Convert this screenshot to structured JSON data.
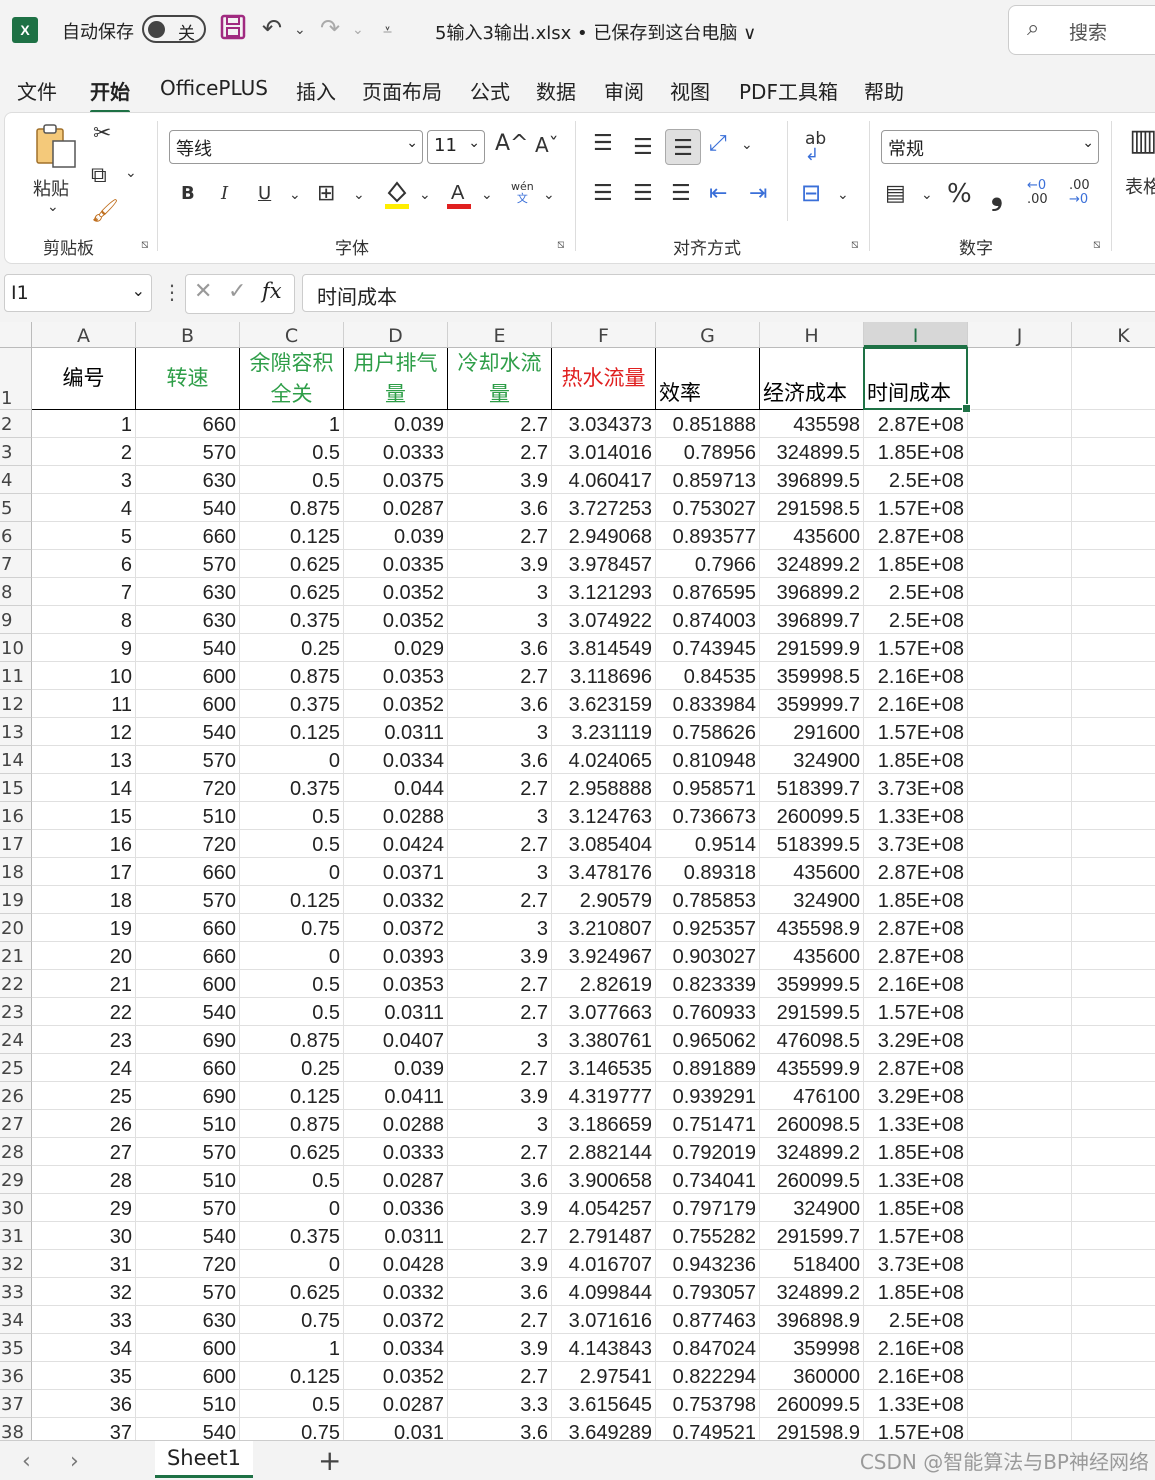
{
  "window": {
    "app_icon": "X",
    "autosave_label": "自动保存",
    "autosave_state": "关",
    "file_title": "5输入3输出.xlsx • 已保存到这台电脑 ∨",
    "search_placeholder": "搜索"
  },
  "menu": {
    "items": [
      "文件",
      "开始",
      "OfficePLUS",
      "插入",
      "页面布局",
      "公式",
      "数据",
      "审阅",
      "视图",
      "PDF工具箱",
      "帮助"
    ],
    "active": "开始"
  },
  "ribbon": {
    "clipboard": {
      "paste_label": "粘贴",
      "group_label": "剪贴板"
    },
    "font": {
      "font_name": "等线",
      "font_size": "11",
      "group_label": "字体",
      "bold": "B",
      "italic": "I",
      "underline": "U",
      "grow": "A^",
      "shrink": "Aˇ",
      "phonetic_top": "wén",
      "phonetic_bottom": "文"
    },
    "alignment": {
      "group_label": "对齐方式",
      "wrap_label": "ab"
    },
    "number": {
      "format": "常规",
      "group_label": "数字",
      "percent": "%",
      "comma": "❟",
      "inc_top": "←0",
      "inc_bottom": ".00",
      "dec_top": ".00",
      "dec_bottom": "→0"
    },
    "tables": {
      "label": "表格"
    }
  },
  "formula_bar": {
    "name_box": "I1",
    "fx": "fx",
    "content": "时间成本"
  },
  "sheet": {
    "columns": [
      "A",
      "B",
      "C",
      "D",
      "E",
      "F",
      "G",
      "H",
      "I",
      "J",
      "K"
    ],
    "selected_column": "I",
    "header_row": [
      {
        "text": "编号",
        "color": "#000000",
        "align": "center"
      },
      {
        "text": "转速",
        "color": "#2e9e48",
        "align": "center"
      },
      {
        "text": "余隙容积全关",
        "color": "#2e9e48",
        "align": "center"
      },
      {
        "text": "用户排气量",
        "color": "#2e9e48",
        "align": "center"
      },
      {
        "text": "冷却水流量",
        "color": "#2e9e48",
        "align": "center"
      },
      {
        "text": "热水流量",
        "color": "#e02020",
        "align": "center"
      },
      {
        "text": "效率",
        "color": "#000000",
        "align": "bottom"
      },
      {
        "text": "经济成本",
        "color": "#000000",
        "align": "bottom"
      },
      {
        "text": "时间成本",
        "color": "#000000",
        "align": "bottom"
      }
    ],
    "rows": [
      [
        "1",
        "660",
        "1",
        "0.039",
        "2.7",
        "3.034373",
        "0.851888",
        "435598",
        "2.87E+08"
      ],
      [
        "2",
        "570",
        "0.5",
        "0.0333",
        "2.7",
        "3.014016",
        "0.78956",
        "324899.5",
        "1.85E+08"
      ],
      [
        "3",
        "630",
        "0.5",
        "0.0375",
        "3.9",
        "4.060417",
        "0.859713",
        "396899.5",
        "2.5E+08"
      ],
      [
        "4",
        "540",
        "0.875",
        "0.0287",
        "3.6",
        "3.727253",
        "0.753027",
        "291598.5",
        "1.57E+08"
      ],
      [
        "5",
        "660",
        "0.125",
        "0.039",
        "2.7",
        "2.949068",
        "0.893577",
        "435600",
        "2.87E+08"
      ],
      [
        "6",
        "570",
        "0.625",
        "0.0335",
        "3.9",
        "3.978457",
        "0.7966",
        "324899.2",
        "1.85E+08"
      ],
      [
        "7",
        "630",
        "0.625",
        "0.0352",
        "3",
        "3.121293",
        "0.876595",
        "396899.2",
        "2.5E+08"
      ],
      [
        "8",
        "630",
        "0.375",
        "0.0352",
        "3",
        "3.074922",
        "0.874003",
        "396899.7",
        "2.5E+08"
      ],
      [
        "9",
        "540",
        "0.25",
        "0.029",
        "3.6",
        "3.814549",
        "0.743945",
        "291599.9",
        "1.57E+08"
      ],
      [
        "10",
        "600",
        "0.875",
        "0.0353",
        "2.7",
        "3.118696",
        "0.84535",
        "359998.5",
        "2.16E+08"
      ],
      [
        "11",
        "600",
        "0.375",
        "0.0352",
        "3.6",
        "3.623159",
        "0.833984",
        "359999.7",
        "2.16E+08"
      ],
      [
        "12",
        "540",
        "0.125",
        "0.0311",
        "3",
        "3.231119",
        "0.758626",
        "291600",
        "1.57E+08"
      ],
      [
        "13",
        "570",
        "0",
        "0.0334",
        "3.6",
        "4.024065",
        "0.810948",
        "324900",
        "1.85E+08"
      ],
      [
        "14",
        "720",
        "0.375",
        "0.044",
        "2.7",
        "2.958888",
        "0.958571",
        "518399.7",
        "3.73E+08"
      ],
      [
        "15",
        "510",
        "0.5",
        "0.0288",
        "3",
        "3.124763",
        "0.736673",
        "260099.5",
        "1.33E+08"
      ],
      [
        "16",
        "720",
        "0.5",
        "0.0424",
        "2.7",
        "3.085404",
        "0.9514",
        "518399.5",
        "3.73E+08"
      ],
      [
        "17",
        "660",
        "0",
        "0.0371",
        "3",
        "3.478176",
        "0.89318",
        "435600",
        "2.87E+08"
      ],
      [
        "18",
        "570",
        "0.125",
        "0.0332",
        "2.7",
        "2.90579",
        "0.785853",
        "324900",
        "1.85E+08"
      ],
      [
        "19",
        "660",
        "0.75",
        "0.0372",
        "3",
        "3.210807",
        "0.925357",
        "435598.9",
        "2.87E+08"
      ],
      [
        "20",
        "660",
        "0",
        "0.0393",
        "3.9",
        "3.924967",
        "0.903027",
        "435600",
        "2.87E+08"
      ],
      [
        "21",
        "600",
        "0.5",
        "0.0353",
        "2.7",
        "2.82619",
        "0.823339",
        "359999.5",
        "2.16E+08"
      ],
      [
        "22",
        "540",
        "0.5",
        "0.0311",
        "2.7",
        "3.077663",
        "0.760933",
        "291599.5",
        "1.57E+08"
      ],
      [
        "23",
        "690",
        "0.875",
        "0.0407",
        "3",
        "3.380761",
        "0.965062",
        "476098.5",
        "3.29E+08"
      ],
      [
        "24",
        "660",
        "0.25",
        "0.039",
        "2.7",
        "3.146535",
        "0.891889",
        "435599.9",
        "2.87E+08"
      ],
      [
        "25",
        "690",
        "0.125",
        "0.0411",
        "3.9",
        "4.319777",
        "0.939291",
        "476100",
        "3.29E+08"
      ],
      [
        "26",
        "510",
        "0.875",
        "0.0288",
        "3",
        "3.186659",
        "0.751471",
        "260098.5",
        "1.33E+08"
      ],
      [
        "27",
        "570",
        "0.625",
        "0.0333",
        "2.7",
        "2.882144",
        "0.792019",
        "324899.2",
        "1.85E+08"
      ],
      [
        "28",
        "510",
        "0.5",
        "0.0287",
        "3.6",
        "3.900658",
        "0.734041",
        "260099.5",
        "1.33E+08"
      ],
      [
        "29",
        "570",
        "0",
        "0.0336",
        "3.9",
        "4.054257",
        "0.797179",
        "324900",
        "1.85E+08"
      ],
      [
        "30",
        "540",
        "0.375",
        "0.0311",
        "2.7",
        "2.791487",
        "0.755282",
        "291599.7",
        "1.57E+08"
      ],
      [
        "31",
        "720",
        "0",
        "0.0428",
        "3.9",
        "4.016707",
        "0.943236",
        "518400",
        "3.73E+08"
      ],
      [
        "32",
        "570",
        "0.625",
        "0.0332",
        "3.6",
        "4.099844",
        "0.793057",
        "324899.2",
        "1.85E+08"
      ],
      [
        "33",
        "630",
        "0.75",
        "0.0372",
        "2.7",
        "3.071616",
        "0.877463",
        "396898.9",
        "2.5E+08"
      ],
      [
        "34",
        "600",
        "1",
        "0.0334",
        "3.9",
        "4.143843",
        "0.847024",
        "359998",
        "2.16E+08"
      ],
      [
        "35",
        "600",
        "0.125",
        "0.0352",
        "2.7",
        "2.97541",
        "0.822294",
        "360000",
        "2.16E+08"
      ],
      [
        "36",
        "510",
        "0.5",
        "0.0287",
        "3.3",
        "3.615645",
        "0.753798",
        "260099.5",
        "1.33E+08"
      ],
      [
        "37",
        "540",
        "0.75",
        "0.031",
        "3.6",
        "3.649289",
        "0.749521",
        "291598.9",
        "1.57E+08"
      ]
    ]
  },
  "sheet_tabs": {
    "tabs": [
      "Sheet1"
    ],
    "active": "Sheet1",
    "add_label": "+"
  },
  "watermark": "CSDN @智能算法与BP神经网络"
}
